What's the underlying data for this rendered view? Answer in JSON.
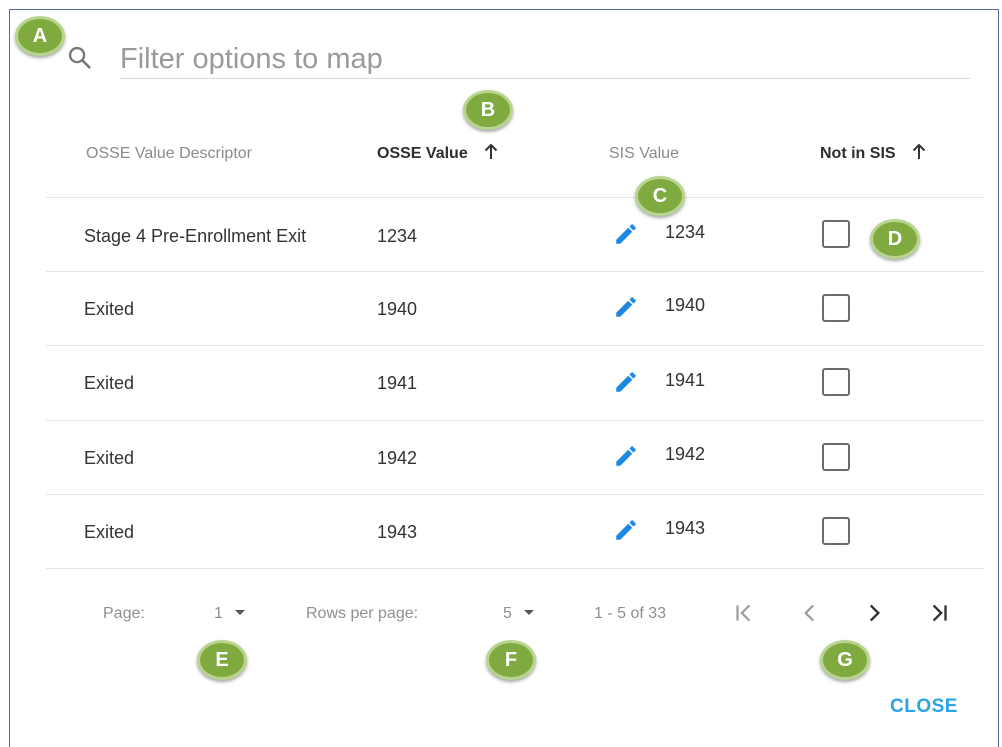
{
  "search": {
    "placeholder": "Filter options to map"
  },
  "table": {
    "columns": [
      {
        "label": "OSSE Value Descriptor",
        "sortable": false
      },
      {
        "label": "OSSE Value",
        "sortable": true
      },
      {
        "label": "SIS Value",
        "sortable": false
      },
      {
        "label": "Not in SIS",
        "sortable": true
      }
    ],
    "rows": [
      {
        "descriptor": "Stage 4 Pre-Enrollment Exit",
        "osse_value": "1234",
        "sis_value": "1234",
        "not_in_sis": false
      },
      {
        "descriptor": "Exited",
        "osse_value": "1940",
        "sis_value": "1940",
        "not_in_sis": false
      },
      {
        "descriptor": "Exited",
        "osse_value": "1941",
        "sis_value": "1941",
        "not_in_sis": false
      },
      {
        "descriptor": "Exited",
        "osse_value": "1942",
        "sis_value": "1942",
        "not_in_sis": false
      },
      {
        "descriptor": "Exited",
        "osse_value": "1943",
        "sis_value": "1943",
        "not_in_sis": false
      }
    ]
  },
  "pagination": {
    "page_label": "Page:",
    "page_value": "1",
    "rows_label": "Rows per page:",
    "rows_value": "5",
    "range_text": "1 - 5 of 33"
  },
  "actions": {
    "close_label": "CLOSE"
  },
  "callouts": [
    "A",
    "B",
    "C",
    "D",
    "E",
    "F",
    "G"
  ],
  "colors": {
    "accent": "#2aa4e6",
    "edit_icon": "#1e88e5",
    "callout": "#7eaa3f",
    "frame_border": "#4f6fa8"
  },
  "icons": {
    "search": "search-icon",
    "sort": "arrow-up-icon",
    "edit": "pencil-icon",
    "first_page": "first-page-icon",
    "prev_page": "chevron-left-icon",
    "next_page": "chevron-right-icon",
    "last_page": "last-page-icon"
  }
}
